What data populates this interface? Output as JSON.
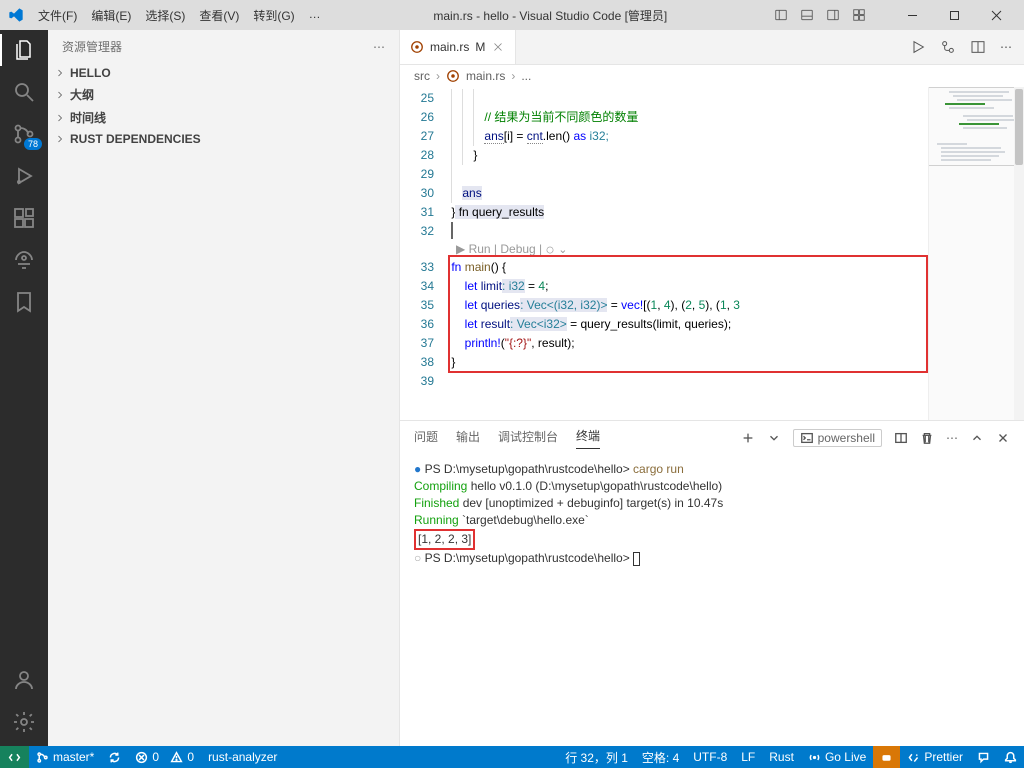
{
  "title": "main.rs - hello - Visual Studio Code [管理员]",
  "menu": [
    "文件(F)",
    "编辑(E)",
    "选择(S)",
    "查看(V)",
    "转到(G)",
    "…"
  ],
  "sidebar": {
    "header": "资源管理器",
    "items": [
      "HELLO",
      "大纲",
      "时间线",
      "RUST DEPENDENCIES"
    ]
  },
  "scm_badge": "78",
  "tab": {
    "name": "main.rs",
    "mod": "M"
  },
  "crumbs": [
    "src",
    "main.rs",
    "..."
  ],
  "lines": {
    "25": "25",
    "26": "26",
    "27": "27",
    "28": "28",
    "29": "29",
    "30": "30",
    "31": "31",
    "32": "32",
    "33": "33",
    "34": "34",
    "35": "35",
    "36": "36",
    "37": "37",
    "38": "38",
    "39": "39"
  },
  "code": {
    "l26_comment": "// 结果为当前不同颜色的数量",
    "l27_ans": "ans",
    "l27_i": "[i] = ",
    "l27_cnt": "cnt",
    "l27_rest": ".len() ",
    "l27_as": "as",
    "l27_i32": " i32;",
    "l30_ans": "ans",
    "l31_brace": "}",
    "l31_fn": " fn query_results",
    "codelens": "▶ Run | Debug |",
    "l33_fn": "fn",
    "l33_main": " main",
    "l33_rest": "() {",
    "l34_let": "let",
    "l34_limit": " limit",
    "l34_type": ": i32",
    "l34_rest": " = ",
    "l34_val": "4",
    "l34_semi": ";",
    "l35_let": "let",
    "l35_q": " queries",
    "l35_type": ": Vec<(i32, i32)>",
    "l35_rest": " = ",
    "l35_vec": "vec!",
    "l35_data": "[(",
    "l35_n1": "1",
    "l35_c": ", ",
    "l35_n2": "4",
    "l35_p": "), (",
    "l35_n3": "2",
    "l35_n4": "5",
    "l35_n5": "1",
    "l35_n6": "3",
    "l36_let": "let",
    "l36_r": " result",
    "l36_type": ": Vec<i32>",
    "l36_rest": " = query_results(limit, queries);",
    "l37_p": "println!",
    "l37_s": "\"{:?}\"",
    "l37_rest": ", result);",
    "l38": "}"
  },
  "panel": {
    "tabs": [
      "问题",
      "输出",
      "调试控制台",
      "终端"
    ],
    "shell": "powershell",
    "t1_prompt": "PS D:\\mysetup\\gopath\\rustcode\\hello> ",
    "t1_cmd": "cargo run",
    "t2": "   Compiling",
    "t2b": " hello v0.1.0 (D:\\mysetup\\gopath\\rustcode\\hello)",
    "t3": "    Finished",
    "t3b": " dev [unoptimized + debuginfo] target(s) in 10.47s",
    "t4": "     Running",
    "t4b": " `target\\debug\\hello.exe`",
    "t5": "[1, 2, 2, 3]",
    "t6": "PS D:\\mysetup\\gopath\\rustcode\\hello> "
  },
  "status": {
    "branch": "master*",
    "errors": "0",
    "warnings": "0",
    "lsp": "rust-analyzer",
    "pos": "行 32，列 1",
    "spaces": "空格: 4",
    "enc": "UTF-8",
    "eol": "LF",
    "lang": "Rust",
    "golive": "Go Live",
    "prettier": "Prettier"
  }
}
